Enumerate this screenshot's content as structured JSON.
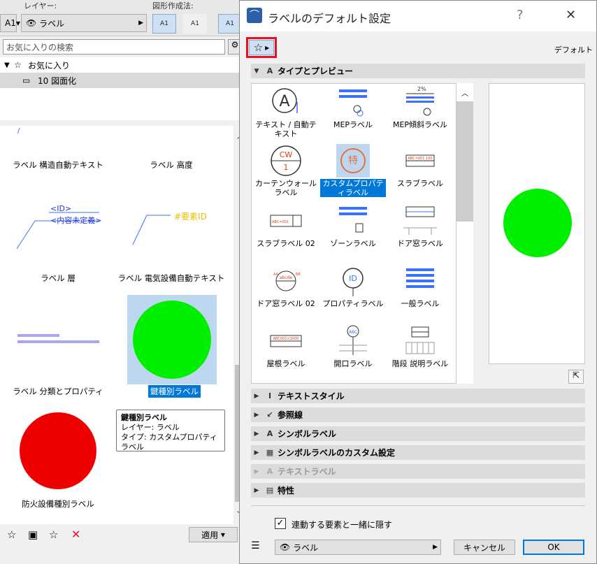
{
  "bg": {
    "layer_caption": "レイヤー:",
    "method_caption": "図形作成法:",
    "layer_value": "ラベル",
    "left_stub": "A1",
    "tool_label": "A1",
    "search_placeholder": "お気に入りの検索",
    "tree_root": "お気に入り",
    "tree_child": "10 図面化",
    "items": [
      "ラベル 構造自動テキスト",
      "ラベル 高度",
      "ラベル 層",
      "ラベル 電気設備自動テキスト",
      "ラベル 分類とプロパティ",
      "鍵種別ラベル",
      "防火設備種別ラベル"
    ],
    "thumb_id_line1": "<ID>",
    "thumb_id_line2": "<内容未定義>",
    "thumb_elem_id": "#要素ID",
    "tooltip": {
      "title": "鍵種別ラベル",
      "line1": "レイヤー: ラベル",
      "line2": "タイプ: カスタムプロパティラベル"
    },
    "apply_button": "適用"
  },
  "dialog": {
    "title": "ラベルのデフォルト設定",
    "help": "?",
    "close": "✕",
    "defaults_label": "デフォルト",
    "section_type": "タイプとプレビュー",
    "grid": [
      "テキスト / 自動テキスト",
      "MEPラベル",
      "MEP傾斜ラベル",
      "カーテンウォールラベル",
      "カスタムプロパティラベル",
      "スラブラベル",
      "スラブラベル 02",
      "ゾーンラベル",
      "ドア窓ラベル",
      "ドア窓ラベル 02",
      "プロパティラベル",
      "一般ラベル",
      "屋根ラベル",
      "開口ラベル",
      "階段 説明ラベル"
    ],
    "sections": [
      "テキストスタイル",
      "参照線",
      "シンボルラベル",
      "シンボルラベルのカスタム設定",
      "テキストラベル",
      "特性"
    ],
    "checkbox_label": "連動する要素と一緒に隠す",
    "layer_value": "ラベル",
    "cancel": "キャンセル",
    "ok": "OK"
  },
  "colors": {
    "selection": "#0078d7",
    "green_preview": "#00ee00",
    "red_marker": "#ee0000",
    "highlight_box": "#e81123"
  }
}
